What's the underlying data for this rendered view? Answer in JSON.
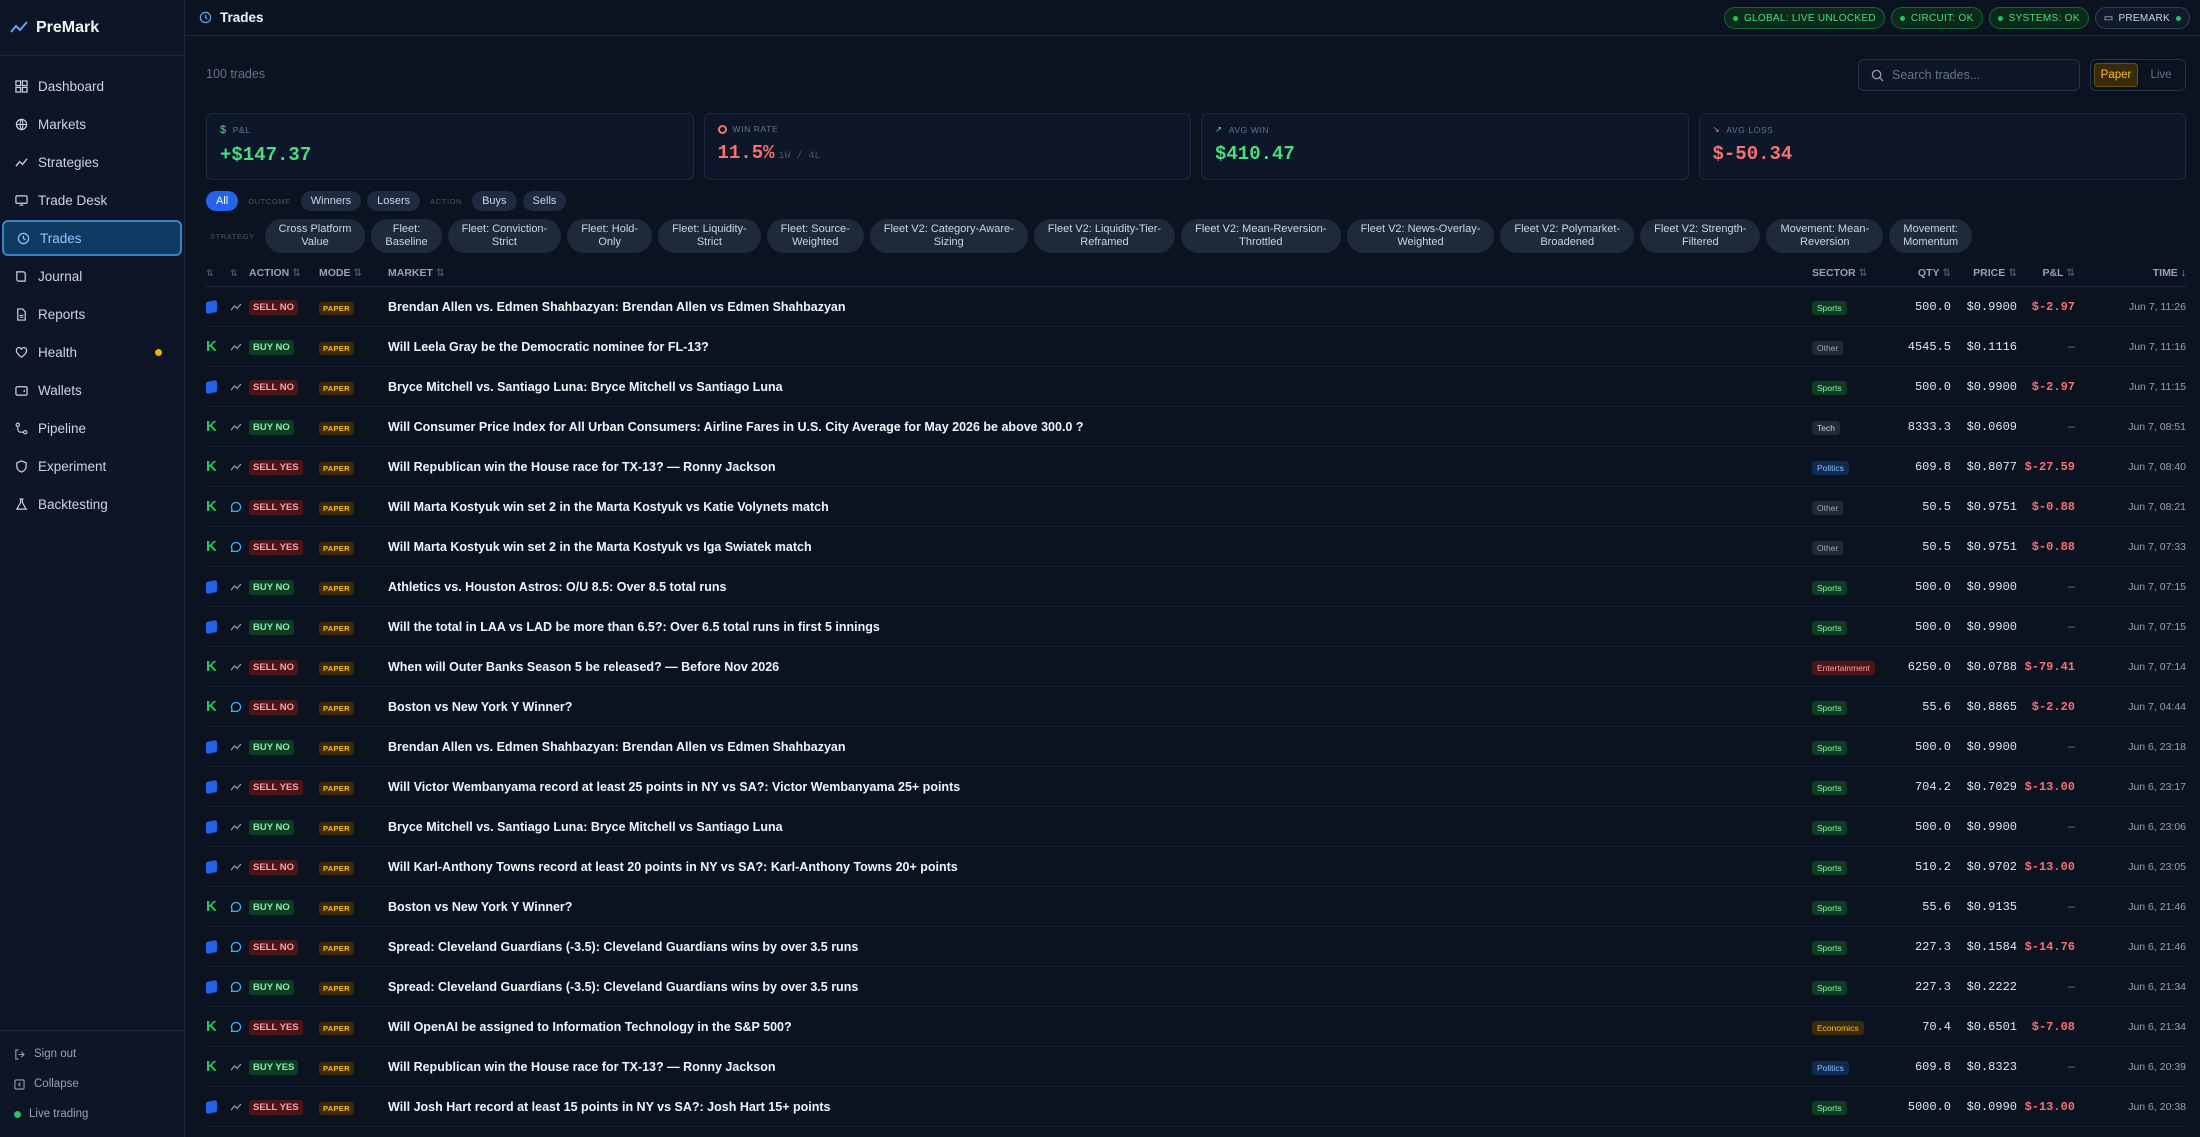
{
  "app": {
    "brand": "PreMark"
  },
  "nav": [
    {
      "label": "Dashboard",
      "icon": "grid-icon"
    },
    {
      "label": "Markets",
      "icon": "globe-icon"
    },
    {
      "label": "Strategies",
      "icon": "trend-icon"
    },
    {
      "label": "Trade Desk",
      "icon": "monitor-icon"
    },
    {
      "label": "Trades",
      "icon": "history-icon",
      "active": true
    },
    {
      "label": "Journal",
      "icon": "book-icon"
    },
    {
      "label": "Reports",
      "icon": "file-icon"
    },
    {
      "label": "Health",
      "icon": "heart-icon",
      "alert": true
    },
    {
      "label": "Wallets",
      "icon": "wallet-icon"
    },
    {
      "label": "Pipeline",
      "icon": "pipeline-icon"
    },
    {
      "label": "Experiment",
      "icon": "shield-icon"
    },
    {
      "label": "Backtesting",
      "icon": "flask-icon"
    }
  ],
  "sidebar_bottom": {
    "signout": "Sign out",
    "collapse": "Collapse",
    "live": "Live trading"
  },
  "header": {
    "title": "Trades"
  },
  "status": {
    "global": "GLOBAL: LIVE UNLOCKED",
    "circuit": "CIRCUIT: OK",
    "systems": "SYSTEMS: OK",
    "account": "PREMARK"
  },
  "toolbar": {
    "count": "100 trades",
    "search_placeholder": "Search trades...",
    "paper": "Paper",
    "live": "Live"
  },
  "stats": {
    "pnl": {
      "label": "P&L",
      "value": "+$147.37"
    },
    "winrate": {
      "label": "WIN RATE",
      "value": "11.5%",
      "sub": "1W / 4L"
    },
    "avgwin": {
      "label": "AVG WIN",
      "value": "$410.47"
    },
    "avgloss": {
      "label": "AVG LOSS",
      "value": "$-50.34"
    }
  },
  "filters": {
    "all": "All",
    "outcome_label": "OUTCOME",
    "winners": "Winners",
    "losers": "Losers",
    "action_label": "ACTION",
    "buys": "Buys",
    "sells": "Sells",
    "strategy_label": "STRATEGY"
  },
  "strategies": [
    {
      "l1": "Cross Platform",
      "l2": "Value"
    },
    {
      "l1": "Fleet:",
      "l2": "Baseline"
    },
    {
      "l1": "Fleet: Conviction-",
      "l2": "Strict"
    },
    {
      "l1": "Fleet: Hold-",
      "l2": "Only"
    },
    {
      "l1": "Fleet: Liquidity-",
      "l2": "Strict"
    },
    {
      "l1": "Fleet: Source-",
      "l2": "Weighted"
    },
    {
      "l1": "Fleet V2: Category-Aware-",
      "l2": "Sizing"
    },
    {
      "l1": "Fleet V2: Liquidity-Tier-",
      "l2": "Reframed"
    },
    {
      "l1": "Fleet V2: Mean-Reversion-",
      "l2": "Throttled"
    },
    {
      "l1": "Fleet V2: News-Overlay-",
      "l2": "Weighted"
    },
    {
      "l1": "Fleet V2: Polymarket-",
      "l2": "Broadened"
    },
    {
      "l1": "Fleet V2: Strength-",
      "l2": "Filtered"
    },
    {
      "l1": "Movement: Mean-",
      "l2": "Reversion"
    },
    {
      "l1": "Movement:",
      "l2": "Momentum"
    }
  ],
  "table": {
    "headers": {
      "action": "ACTION",
      "mode": "MODE",
      "market": "MARKET",
      "sector": "SECTOR",
      "qty": "QTY",
      "price": "PRICE",
      "pnl": "P&L",
      "time": "TIME"
    },
    "rows": [
      {
        "src": "poly",
        "ico": "trend",
        "action": "SELL NO",
        "mode": "PAPER",
        "market": "Brendan Allen vs. Edmen Shahbazyan: Brendan Allen vs Edmen Shahbazyan",
        "sector": "Sports",
        "qty": "500.0",
        "price": "$0.9900",
        "pnl": "$-2.97",
        "time": "Jun 7, 11:26"
      },
      {
        "src": "kalshi",
        "ico": "trend",
        "action": "BUY NO",
        "mode": "PAPER",
        "market": "Will Leela Gray be the Democratic nominee for FL-13?",
        "sector": "Other",
        "qty": "4545.5",
        "price": "$0.1116",
        "pnl": "—",
        "time": "Jun 7, 11:16"
      },
      {
        "src": "poly",
        "ico": "trend",
        "action": "SELL NO",
        "mode": "PAPER",
        "market": "Bryce Mitchell vs. Santiago Luna: Bryce Mitchell vs Santiago Luna",
        "sector": "Sports",
        "qty": "500.0",
        "price": "$0.9900",
        "pnl": "$-2.97",
        "time": "Jun 7, 11:15"
      },
      {
        "src": "kalshi",
        "ico": "trend",
        "action": "BUY NO",
        "mode": "PAPER",
        "market": "Will Consumer Price Index for All Urban Consumers: Airline Fares in U.S. City Average for May 2026 be above 300.0   ?",
        "sector": "Tech",
        "qty": "8333.3",
        "price": "$0.0609",
        "pnl": "—",
        "time": "Jun 7, 08:51"
      },
      {
        "src": "kalshi",
        "ico": "trend",
        "action": "SELL YES",
        "mode": "PAPER",
        "market": "Will Republican win the House race for TX-13? — Ronny Jackson",
        "sector": "Politics",
        "qty": "609.8",
        "price": "$0.8077",
        "pnl": "$-27.59",
        "time": "Jun 7, 08:40"
      },
      {
        "src": "kalshi",
        "ico": "chat",
        "action": "SELL YES",
        "mode": "PAPER",
        "market": "Will Marta Kostyuk win set 2 in the Marta Kostyuk vs Katie Volynets match",
        "sector": "Other",
        "qty": "50.5",
        "price": "$0.9751",
        "pnl": "$-0.88",
        "time": "Jun 7, 08:21"
      },
      {
        "src": "kalshi",
        "ico": "chat",
        "action": "SELL YES",
        "mode": "PAPER",
        "market": "Will Marta Kostyuk win set 2 in the Marta Kostyuk vs Iga Swiatek match",
        "sector": "Other",
        "qty": "50.5",
        "price": "$0.9751",
        "pnl": "$-0.88",
        "time": "Jun 7, 07:33"
      },
      {
        "src": "poly",
        "ico": "trend",
        "action": "BUY NO",
        "mode": "PAPER",
        "market": "Athletics vs. Houston Astros: O/U 8.5: Over 8.5 total runs",
        "sector": "Sports",
        "qty": "500.0",
        "price": "$0.9900",
        "pnl": "—",
        "time": "Jun 7, 07:15"
      },
      {
        "src": "poly",
        "ico": "trend",
        "action": "BUY NO",
        "mode": "PAPER",
        "market": "Will the total in LAA vs LAD be more than 6.5?: Over 6.5 total runs in first 5 innings",
        "sector": "Sports",
        "qty": "500.0",
        "price": "$0.9900",
        "pnl": "—",
        "time": "Jun 7, 07:15"
      },
      {
        "src": "kalshi",
        "ico": "trend",
        "action": "SELL NO",
        "mode": "PAPER",
        "market": "When will Outer Banks Season 5 be released? — Before Nov 2026",
        "sector": "Entertainment",
        "qty": "6250.0",
        "price": "$0.0788",
        "pnl": "$-79.41",
        "time": "Jun 7, 07:14"
      },
      {
        "src": "kalshi",
        "ico": "chat",
        "action": "SELL NO",
        "mode": "PAPER",
        "market": "Boston vs New York Y Winner?",
        "sector": "Sports",
        "qty": "55.6",
        "price": "$0.8865",
        "pnl": "$-2.20",
        "time": "Jun 7, 04:44"
      },
      {
        "src": "poly",
        "ico": "trend",
        "action": "BUY NO",
        "mode": "PAPER",
        "market": "Brendan Allen vs. Edmen Shahbazyan: Brendan Allen vs Edmen Shahbazyan",
        "sector": "Sports",
        "qty": "500.0",
        "price": "$0.9900",
        "pnl": "—",
        "time": "Jun 6, 23:18"
      },
      {
        "src": "poly",
        "ico": "trend",
        "action": "SELL YES",
        "mode": "PAPER",
        "market": "Will Victor Wembanyama record at least 25 points in NY vs SA?: Victor Wembanyama 25+ points",
        "sector": "Sports",
        "qty": "704.2",
        "price": "$0.7029",
        "pnl": "$-13.00",
        "time": "Jun 6, 23:17"
      },
      {
        "src": "poly",
        "ico": "trend",
        "action": "BUY NO",
        "mode": "PAPER",
        "market": "Bryce Mitchell vs. Santiago Luna: Bryce Mitchell vs Santiago Luna",
        "sector": "Sports",
        "qty": "500.0",
        "price": "$0.9900",
        "pnl": "—",
        "time": "Jun 6, 23:06"
      },
      {
        "src": "poly",
        "ico": "trend",
        "action": "SELL NO",
        "mode": "PAPER",
        "market": "Will Karl-Anthony Towns record at least 20 points in NY vs SA?: Karl-Anthony Towns 20+ points",
        "sector": "Sports",
        "qty": "510.2",
        "price": "$0.9702",
        "pnl": "$-13.00",
        "time": "Jun 6, 23:05"
      },
      {
        "src": "kalshi",
        "ico": "chat",
        "action": "BUY NO",
        "mode": "PAPER",
        "market": "Boston vs New York Y Winner?",
        "sector": "Sports",
        "qty": "55.6",
        "price": "$0.9135",
        "pnl": "—",
        "time": "Jun 6, 21:46"
      },
      {
        "src": "poly",
        "ico": "chat",
        "action": "SELL NO",
        "mode": "PAPER",
        "market": "Spread: Cleveland Guardians (-3.5): Cleveland Guardians wins by over 3.5 runs",
        "sector": "Sports",
        "qty": "227.3",
        "price": "$0.1584",
        "pnl": "$-14.76",
        "time": "Jun 6, 21:46"
      },
      {
        "src": "poly",
        "ico": "chat",
        "action": "BUY NO",
        "mode": "PAPER",
        "market": "Spread: Cleveland Guardians (-3.5): Cleveland Guardians wins by over 3.5 runs",
        "sector": "Sports",
        "qty": "227.3",
        "price": "$0.2222",
        "pnl": "—",
        "time": "Jun 6, 21:34"
      },
      {
        "src": "kalshi",
        "ico": "chat",
        "action": "SELL YES",
        "mode": "PAPER",
        "market": "Will OpenAI be assigned to Information Technology in the S&P 500?",
        "sector": "Economics",
        "qty": "70.4",
        "price": "$0.6501",
        "pnl": "$-7.08",
        "time": "Jun 6, 21:34"
      },
      {
        "src": "kalshi",
        "ico": "trend",
        "action": "BUY YES",
        "mode": "PAPER",
        "market": "Will Republican win the House race for TX-13? — Ronny Jackson",
        "sector": "Politics",
        "qty": "609.8",
        "price": "$0.8323",
        "pnl": "—",
        "time": "Jun 6, 20:39"
      },
      {
        "src": "poly",
        "ico": "trend",
        "action": "SELL YES",
        "mode": "PAPER",
        "market": "Will Josh Hart record at least 15 points in NY vs SA?: Josh Hart 15+ points",
        "sector": "Sports",
        "qty": "5000.0",
        "price": "$0.0990",
        "pnl": "$-13.00",
        "time": "Jun 6, 20:38"
      }
    ]
  }
}
